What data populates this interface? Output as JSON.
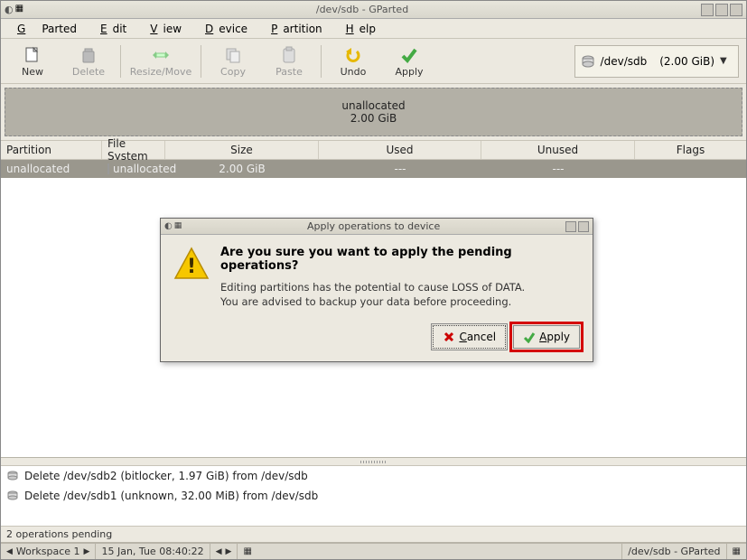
{
  "titlebar": {
    "title": "/dev/sdb - GParted"
  },
  "menubar": {
    "items": [
      "GParted",
      "Edit",
      "View",
      "Device",
      "Partition",
      "Help"
    ]
  },
  "toolbar": {
    "new": "New",
    "delete": "Delete",
    "resize": "Resize/Move",
    "copy": "Copy",
    "paste": "Paste",
    "undo": "Undo",
    "apply": "Apply"
  },
  "drive_selector": {
    "device": "/dev/sdb",
    "size": "(2.00 GiB)"
  },
  "graphic": {
    "label": "unallocated",
    "size": "2.00 GiB"
  },
  "table": {
    "headers": {
      "partition": "Partition",
      "fs": "File System",
      "size": "Size",
      "used": "Used",
      "unused": "Unused",
      "flags": "Flags"
    },
    "rows": [
      {
        "partition": "unallocated",
        "fs": "unallocated",
        "size": "2.00 GiB",
        "used": "---",
        "unused": "---",
        "flags": ""
      }
    ]
  },
  "pending": {
    "items": [
      "Delete /dev/sdb2 (bitlocker, 1.97 GiB) from /dev/sdb",
      "Delete /dev/sdb1 (unknown, 32.00 MiB) from /dev/sdb"
    ]
  },
  "statusbar": {
    "text": "2 operations pending"
  },
  "taskbar": {
    "workspace": "Workspace 1",
    "clock": "15 Jan, Tue 08:40:22",
    "active": "/dev/sdb - GParted"
  },
  "dialog": {
    "title": "Apply operations to device",
    "heading": "Are you sure you want to apply the pending operations?",
    "line1": "Editing partitions has the potential to cause LOSS of DATA.",
    "line2": "You are advised to backup your data before proceeding.",
    "cancel": "Cancel",
    "apply": "Apply"
  }
}
